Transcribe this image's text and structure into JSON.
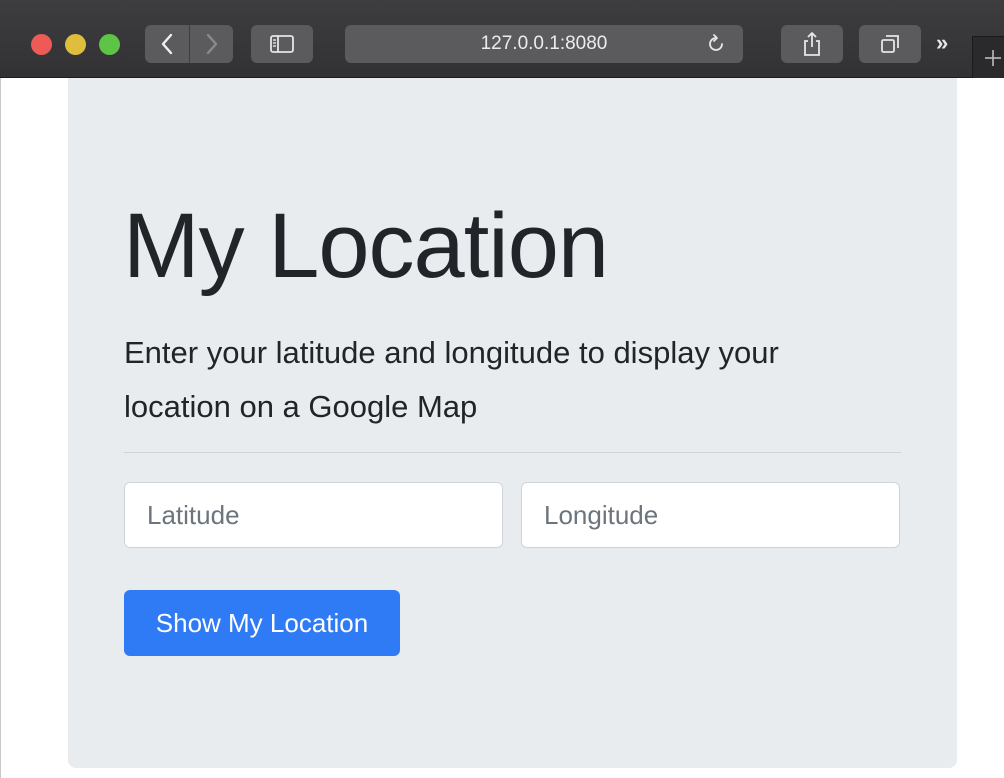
{
  "browser": {
    "url": "127.0.0.1:8080",
    "overflow_label": "»",
    "icons": {
      "back": "chevron-left-icon",
      "forward": "chevron-right-icon",
      "sidebar": "sidebar-icon",
      "reload": "reload-icon",
      "share": "share-icon",
      "tabs": "tabs-icon",
      "new_tab": "plus-icon"
    }
  },
  "page": {
    "title": "My Location",
    "lead": "Enter your latitude and longitude to display your location on a Google Map",
    "latitude": {
      "value": "",
      "placeholder": "Latitude"
    },
    "longitude": {
      "value": "",
      "placeholder": "Longitude"
    },
    "submit_label": "Show My Location"
  },
  "colors": {
    "primary": "#2f7bf5",
    "jumbotron_bg": "#e9ecef",
    "text": "#212529",
    "placeholder": "#6c757d"
  }
}
